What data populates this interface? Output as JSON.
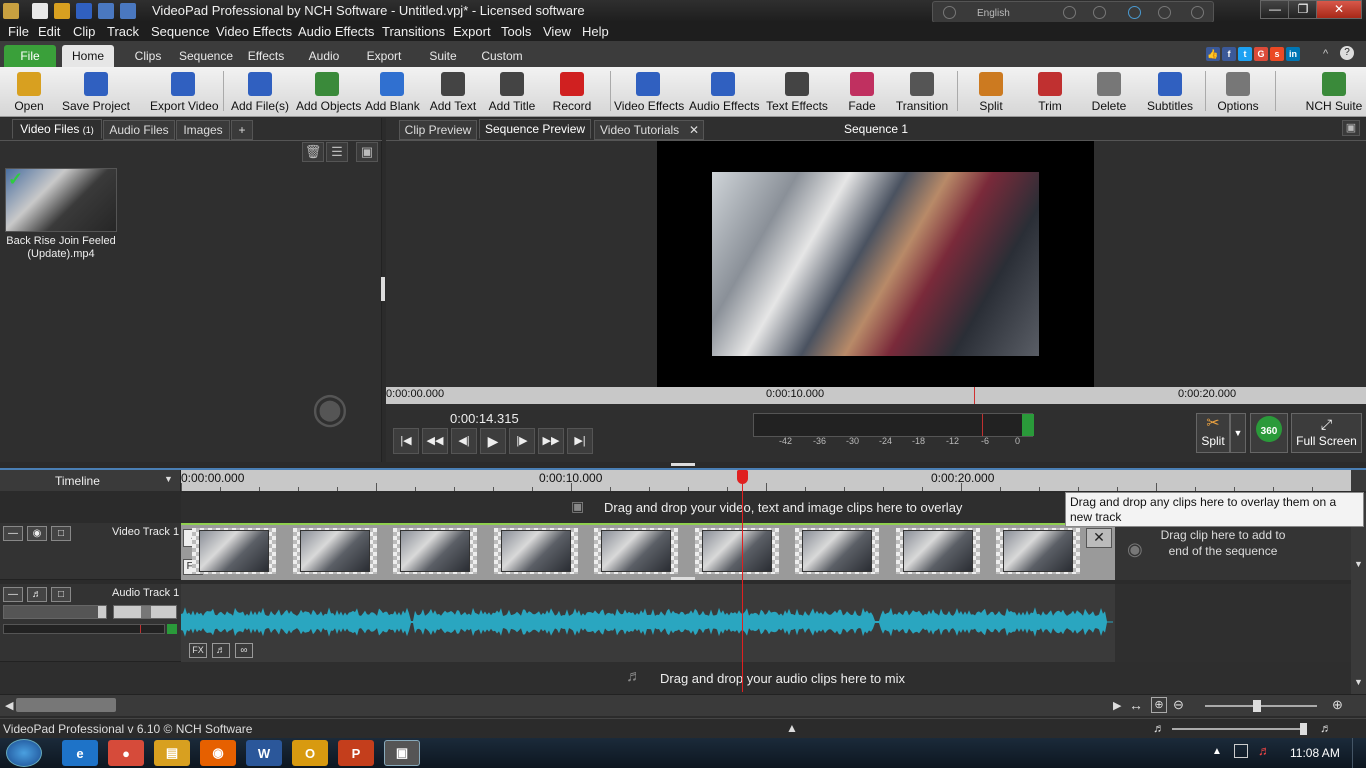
{
  "window": {
    "title": "VideoPad Professional by NCH Software - Untitled.vpj* - Licensed software",
    "language": "English",
    "min_label": "—",
    "max_label": "❐",
    "close_label": "✕"
  },
  "menu": [
    "File",
    "Edit",
    "Clip",
    "Track",
    "Sequence",
    "Video Effects",
    "Audio Effects",
    "Transitions",
    "Export",
    "Tools",
    "View",
    "Help"
  ],
  "ribbon_tabs": [
    "File",
    "Home",
    "Clips",
    "Sequence",
    "Effects",
    "Audio",
    "Export",
    "Suite",
    "Custom"
  ],
  "toolbar": [
    {
      "label": "Open",
      "icon": "folder-open-icon",
      "color": "#d8a020"
    },
    {
      "label": "Save Project",
      "icon": "save-icon",
      "color": "#3060c0"
    },
    {
      "label": "Export Video",
      "icon": "export-video-icon",
      "color": "#3060c0"
    },
    {
      "label": "Add File(s)",
      "icon": "add-file-icon",
      "color": "#3060c0"
    },
    {
      "label": "Add Objects",
      "icon": "add-objects-icon",
      "color": "#3a8a3a"
    },
    {
      "label": "Add Blank",
      "icon": "add-blank-icon",
      "color": "#3070d0"
    },
    {
      "label": "Add Text",
      "icon": "text-icon",
      "color": "#444444"
    },
    {
      "label": "Add Title",
      "icon": "title-icon",
      "color": "#444444"
    },
    {
      "label": "Record",
      "icon": "record-icon",
      "color": "#d02020"
    },
    {
      "label": "Video Effects",
      "icon": "video-fx-icon",
      "color": "#3060c0"
    },
    {
      "label": "Audio Effects",
      "icon": "audio-fx-icon",
      "color": "#3060c0"
    },
    {
      "label": "Text Effects",
      "icon": "text-effects-icon",
      "color": "#444444"
    },
    {
      "label": "Fade",
      "icon": "fade-icon",
      "color": "#c03060"
    },
    {
      "label": "Transition",
      "icon": "transition-icon",
      "color": "#555555"
    },
    {
      "label": "Split",
      "icon": "scissors-icon",
      "color": "#cc7a20"
    },
    {
      "label": "Trim",
      "icon": "trim-icon",
      "color": "#c03030"
    },
    {
      "label": "Delete",
      "icon": "trash-icon",
      "color": "#777777"
    },
    {
      "label": "Subtitles",
      "icon": "subtitles-icon",
      "color": "#3060c0"
    },
    {
      "label": "Options",
      "icon": "options-icon",
      "color": "#777777"
    },
    {
      "label": "NCH Suite",
      "icon": "nch-suite-icon",
      "color": "#3a8a3a"
    }
  ],
  "social": [
    {
      "name": "like",
      "glyph": "👍",
      "color": "#3b5998"
    },
    {
      "name": "facebook",
      "glyph": "f",
      "color": "#3b5998"
    },
    {
      "name": "twitter",
      "glyph": "t",
      "color": "#1da1f2"
    },
    {
      "name": "google",
      "glyph": "G",
      "color": "#dd4b39"
    },
    {
      "name": "stumbleupon",
      "glyph": "s",
      "color": "#eb4924"
    },
    {
      "name": "linkedin",
      "glyph": "in",
      "color": "#0077b5"
    }
  ],
  "help_label": "?",
  "media_tabs": [
    {
      "label": "Video Files",
      "count": "(1)"
    },
    {
      "label": "Audio Files"
    },
    {
      "label": "Images"
    },
    {
      "label": "+"
    }
  ],
  "media_file": {
    "name": "Back Rise Join Feeled (Update).mp4"
  },
  "preview_tabs": [
    "Clip Preview",
    "Sequence Preview",
    "Video Tutorials"
  ],
  "sequence_title": "Sequence 1",
  "preview_ruler": [
    "0:00:00.000",
    "0:00:10.000",
    "0:00:20.000"
  ],
  "current_time": "0:00:14.315",
  "vu_labels": [
    "-42",
    "-36",
    "-30",
    "-24",
    "-18",
    "-12",
    "-6",
    "0"
  ],
  "right_buttons": {
    "split": "Split",
    "vr": "360",
    "fullscreen": "Full Screen"
  },
  "timeline": {
    "label": "Timeline",
    "ruler": [
      "0:00:00.000",
      "0:00:10.000",
      "0:00:20.000"
    ],
    "overlay_hint": "Drag and drop your video, text and image clips here to overlay",
    "video_track": "Video Track 1",
    "audio_track": "Audio Track 1",
    "end_hint": "Drag clip here to add to end of the sequence",
    "audio_hint": "Drag and drop your audio clips here to mix",
    "fx_label": "FX"
  },
  "tooltip": "Drag and drop any clips here to overlay them on a new track",
  "status": "VideoPad Professional v 6.10 © NCH Software",
  "clock": "11:08 AM",
  "taskbar_apps": [
    {
      "name": "internet-explorer",
      "glyph": "e",
      "color": "#1e73c8"
    },
    {
      "name": "chrome",
      "glyph": "●",
      "color": "#d64b3a"
    },
    {
      "name": "explorer",
      "glyph": "▤",
      "color": "#d8a020"
    },
    {
      "name": "firefox",
      "glyph": "◉",
      "color": "#e66000"
    },
    {
      "name": "word",
      "glyph": "W",
      "color": "#2b579a"
    },
    {
      "name": "outlook",
      "glyph": "O",
      "color": "#d89a10"
    },
    {
      "name": "powerpoint",
      "glyph": "P",
      "color": "#c43e1c"
    },
    {
      "name": "videopad",
      "glyph": "▣",
      "color": "#555555"
    }
  ]
}
